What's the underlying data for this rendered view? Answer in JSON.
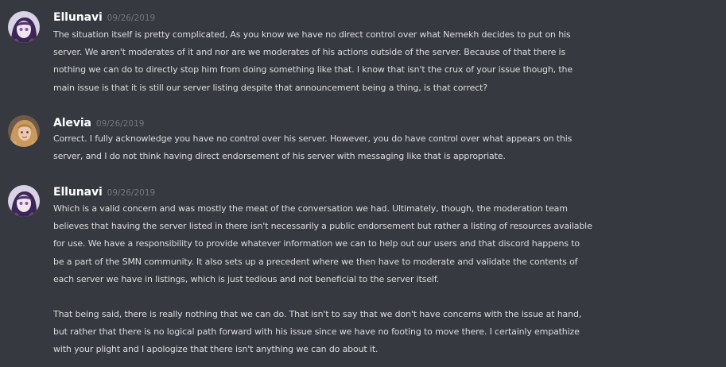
{
  "messages": [
    {
      "author": "Ellunavi",
      "timestamp": "09/26/2019",
      "avatar_icon": "anime-girl-avatar-icon",
      "paragraphs": [
        [
          "The situation itself is pretty complicated, As you know we have no direct control over what Nemekh decides to put on his",
          "server. We aren't moderates of it and nor are we moderates of his actions outside of the server. Because of that there is",
          "nothing we can do to directly stop him from doing something like that. I know that isn't the crux of your issue though, the",
          "main issue is that it is still our server listing despite that announcement being a thing, is that correct?"
        ]
      ]
    },
    {
      "author": "Alevia",
      "timestamp": "09/26/2019",
      "avatar_icon": "blonde-user-avatar-icon",
      "paragraphs": [
        [
          "Correct. I fully acknowledge you have no control over his server. However, you do have control over what appears on this",
          "server, and I do not think having direct endorsement of his server with messaging like that is appropriate."
        ]
      ]
    },
    {
      "author": "Ellunavi",
      "timestamp": "09/26/2019",
      "avatar_icon": "anime-girl-avatar-icon",
      "paragraphs": [
        [
          "Which is a valid concern and was mostly the meat of the conversation we had. Ultimately, though, the moderation team",
          "believes that having the server listed in there isn't necessarily a public endorsement but rather a listing of resources available",
          "for use. We have a responsibility to provide whatever information we can to help out our users and that discord happens to",
          "be a part of the SMN community. It also sets up a precedent where we then have to moderate and validate the contents of",
          "each server we have in listings, which is just tedious and not beneficial to the server itself."
        ],
        [
          "That being said, there is really nothing that we can do. That isn't to say that we don't have concerns with the issue at hand,",
          "but rather that there is no logical path forward with his issue since we have no footing to move there.  I certainly empathize",
          "with your plight and I apologize that there isn't anything we can do about it."
        ]
      ]
    }
  ],
  "colors": {
    "background": "#36393f",
    "author": "#ffffff",
    "timestamp": "#72767d",
    "text": "#dcddde"
  }
}
